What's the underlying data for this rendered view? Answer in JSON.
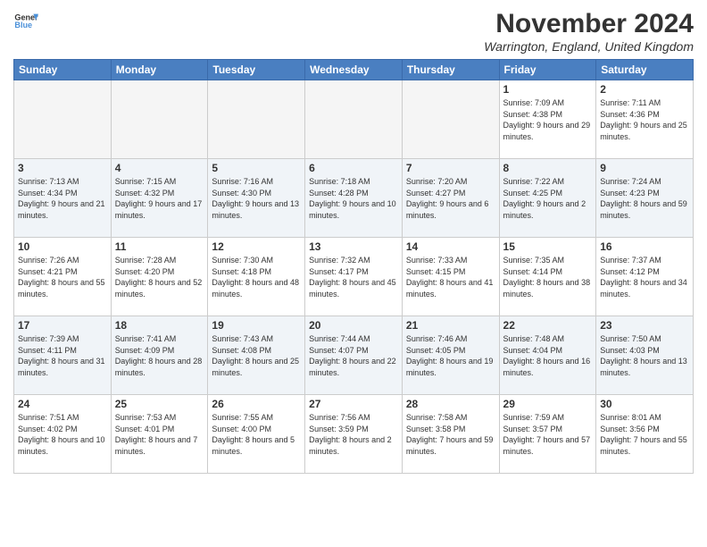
{
  "header": {
    "logo_line1": "General",
    "logo_line2": "Blue",
    "month": "November 2024",
    "location": "Warrington, England, United Kingdom"
  },
  "weekdays": [
    "Sunday",
    "Monday",
    "Tuesday",
    "Wednesday",
    "Thursday",
    "Friday",
    "Saturday"
  ],
  "weeks": [
    [
      {
        "day": "",
        "info": ""
      },
      {
        "day": "",
        "info": ""
      },
      {
        "day": "",
        "info": ""
      },
      {
        "day": "",
        "info": ""
      },
      {
        "day": "",
        "info": ""
      },
      {
        "day": "1",
        "info": "Sunrise: 7:09 AM\nSunset: 4:38 PM\nDaylight: 9 hours and 29 minutes."
      },
      {
        "day": "2",
        "info": "Sunrise: 7:11 AM\nSunset: 4:36 PM\nDaylight: 9 hours and 25 minutes."
      }
    ],
    [
      {
        "day": "3",
        "info": "Sunrise: 7:13 AM\nSunset: 4:34 PM\nDaylight: 9 hours and 21 minutes."
      },
      {
        "day": "4",
        "info": "Sunrise: 7:15 AM\nSunset: 4:32 PM\nDaylight: 9 hours and 17 minutes."
      },
      {
        "day": "5",
        "info": "Sunrise: 7:16 AM\nSunset: 4:30 PM\nDaylight: 9 hours and 13 minutes."
      },
      {
        "day": "6",
        "info": "Sunrise: 7:18 AM\nSunset: 4:28 PM\nDaylight: 9 hours and 10 minutes."
      },
      {
        "day": "7",
        "info": "Sunrise: 7:20 AM\nSunset: 4:27 PM\nDaylight: 9 hours and 6 minutes."
      },
      {
        "day": "8",
        "info": "Sunrise: 7:22 AM\nSunset: 4:25 PM\nDaylight: 9 hours and 2 minutes."
      },
      {
        "day": "9",
        "info": "Sunrise: 7:24 AM\nSunset: 4:23 PM\nDaylight: 8 hours and 59 minutes."
      }
    ],
    [
      {
        "day": "10",
        "info": "Sunrise: 7:26 AM\nSunset: 4:21 PM\nDaylight: 8 hours and 55 minutes."
      },
      {
        "day": "11",
        "info": "Sunrise: 7:28 AM\nSunset: 4:20 PM\nDaylight: 8 hours and 52 minutes."
      },
      {
        "day": "12",
        "info": "Sunrise: 7:30 AM\nSunset: 4:18 PM\nDaylight: 8 hours and 48 minutes."
      },
      {
        "day": "13",
        "info": "Sunrise: 7:32 AM\nSunset: 4:17 PM\nDaylight: 8 hours and 45 minutes."
      },
      {
        "day": "14",
        "info": "Sunrise: 7:33 AM\nSunset: 4:15 PM\nDaylight: 8 hours and 41 minutes."
      },
      {
        "day": "15",
        "info": "Sunrise: 7:35 AM\nSunset: 4:14 PM\nDaylight: 8 hours and 38 minutes."
      },
      {
        "day": "16",
        "info": "Sunrise: 7:37 AM\nSunset: 4:12 PM\nDaylight: 8 hours and 34 minutes."
      }
    ],
    [
      {
        "day": "17",
        "info": "Sunrise: 7:39 AM\nSunset: 4:11 PM\nDaylight: 8 hours and 31 minutes."
      },
      {
        "day": "18",
        "info": "Sunrise: 7:41 AM\nSunset: 4:09 PM\nDaylight: 8 hours and 28 minutes."
      },
      {
        "day": "19",
        "info": "Sunrise: 7:43 AM\nSunset: 4:08 PM\nDaylight: 8 hours and 25 minutes."
      },
      {
        "day": "20",
        "info": "Sunrise: 7:44 AM\nSunset: 4:07 PM\nDaylight: 8 hours and 22 minutes."
      },
      {
        "day": "21",
        "info": "Sunrise: 7:46 AM\nSunset: 4:05 PM\nDaylight: 8 hours and 19 minutes."
      },
      {
        "day": "22",
        "info": "Sunrise: 7:48 AM\nSunset: 4:04 PM\nDaylight: 8 hours and 16 minutes."
      },
      {
        "day": "23",
        "info": "Sunrise: 7:50 AM\nSunset: 4:03 PM\nDaylight: 8 hours and 13 minutes."
      }
    ],
    [
      {
        "day": "24",
        "info": "Sunrise: 7:51 AM\nSunset: 4:02 PM\nDaylight: 8 hours and 10 minutes."
      },
      {
        "day": "25",
        "info": "Sunrise: 7:53 AM\nSunset: 4:01 PM\nDaylight: 8 hours and 7 minutes."
      },
      {
        "day": "26",
        "info": "Sunrise: 7:55 AM\nSunset: 4:00 PM\nDaylight: 8 hours and 5 minutes."
      },
      {
        "day": "27",
        "info": "Sunrise: 7:56 AM\nSunset: 3:59 PM\nDaylight: 8 hours and 2 minutes."
      },
      {
        "day": "28",
        "info": "Sunrise: 7:58 AM\nSunset: 3:58 PM\nDaylight: 7 hours and 59 minutes."
      },
      {
        "day": "29",
        "info": "Sunrise: 7:59 AM\nSunset: 3:57 PM\nDaylight: 7 hours and 57 minutes."
      },
      {
        "day": "30",
        "info": "Sunrise: 8:01 AM\nSunset: 3:56 PM\nDaylight: 7 hours and 55 minutes."
      }
    ]
  ]
}
